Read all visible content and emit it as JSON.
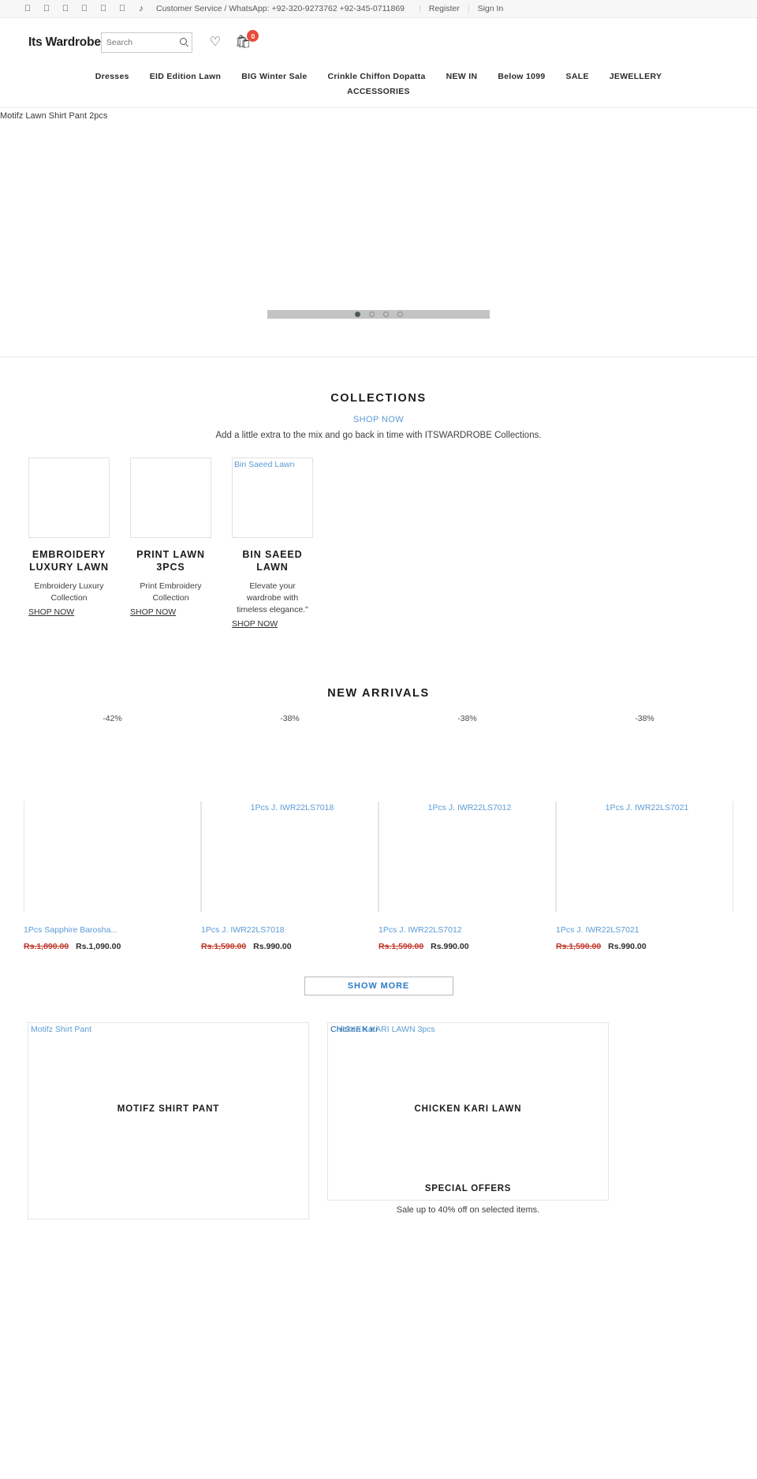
{
  "topbar": {
    "social_icons": [
      "facebook-icon",
      "instagram-icon",
      "twitter-icon",
      "youtube-icon",
      "pinterest-icon",
      "snapchat-icon"
    ],
    "tiktok_glyph": "♪",
    "contact_text": "Customer Service / WhatsApp: +92-320-9273762 +92-345-0711869",
    "register_label": "Register",
    "signin_label": "Sign In",
    "separator": "|"
  },
  "header": {
    "brand": "Its Wardrobe",
    "search_placeholder": "Search",
    "search_value": "",
    "cart_count": "0"
  },
  "nav": {
    "row1": [
      {
        "label": "Dresses"
      },
      {
        "label": "EID Edition Lawn"
      },
      {
        "label": "BIG Winter Sale"
      },
      {
        "label": "Crinkle Chiffon Dopatta"
      },
      {
        "label": "NEW IN"
      },
      {
        "label": "Below 1099"
      },
      {
        "label": "SALE"
      },
      {
        "label": "JEWELLERY"
      }
    ],
    "row2": [
      {
        "label": "ACCESSORIES"
      }
    ]
  },
  "hero": {
    "alt_text": "Motifz Lawn Shirt Pant 2pcs",
    "dots": [
      "1",
      "2",
      "3",
      "4"
    ],
    "active_dot": 0
  },
  "collections": {
    "title": "COLLECTIONS",
    "shop_now": "SHOP NOW",
    "subtitle": "Add a little extra to the mix and go back in time with ITSWARDROBE Collections.",
    "cards": [
      {
        "alt": "",
        "name": "EMBROIDERY LUXURY LAWN",
        "desc": "Embroidery Luxury Collection",
        "link": "SHOP NOW"
      },
      {
        "alt": "",
        "name": "PRINT LAWN 3PCS",
        "desc": "Print Embroidery Collection",
        "link": "SHOP NOW"
      },
      {
        "alt": "Bin Saeed Lawn",
        "name": "BIN SAEED LAWN",
        "desc": "Elevate your wardrobe with timeless elegance.\"",
        "link": "SHOP NOW"
      }
    ]
  },
  "arrivals": {
    "title": "NEW ARRIVALS",
    "show_more": "SHOW MORE",
    "products": [
      {
        "badge": "-42%",
        "alt": "",
        "title": "1Pcs Sapphire Barosha...",
        "price_old": "Rs.1,890.00",
        "price_new": "Rs.1,090.00"
      },
      {
        "badge": "-38%",
        "alt": "1Pcs J. IWR22LS7018",
        "title": "1Pcs J. IWR22LS7018",
        "price_old": "Rs.1,590.00",
        "price_new": "Rs.990.00"
      },
      {
        "badge": "-38%",
        "alt": "1Pcs J. IWR22LS7012",
        "title": "1Pcs J. IWR22LS7012",
        "price_old": "Rs.1,590.00",
        "price_new": "Rs.990.00"
      },
      {
        "badge": "-38%",
        "alt": "1Pcs J. IWR22LS7021",
        "title": "1Pcs J. IWR22LS7021",
        "price_old": "Rs.1,590.00",
        "price_new": "Rs.990.00"
      }
    ]
  },
  "banners": {
    "left": {
      "alt": "Motifz Shirt Pant",
      "caption": "MOTIFZ SHIRT PANT"
    },
    "right": {
      "alt": "Chicken Kari",
      "alt_overlap": "CHICKEN KARI LAWN 3pcs",
      "caption": "CHICKEN KARI LAWN",
      "special_title": "SPECIAL OFFERS",
      "special_sub": "Sale up to 40% off on selected items."
    }
  }
}
